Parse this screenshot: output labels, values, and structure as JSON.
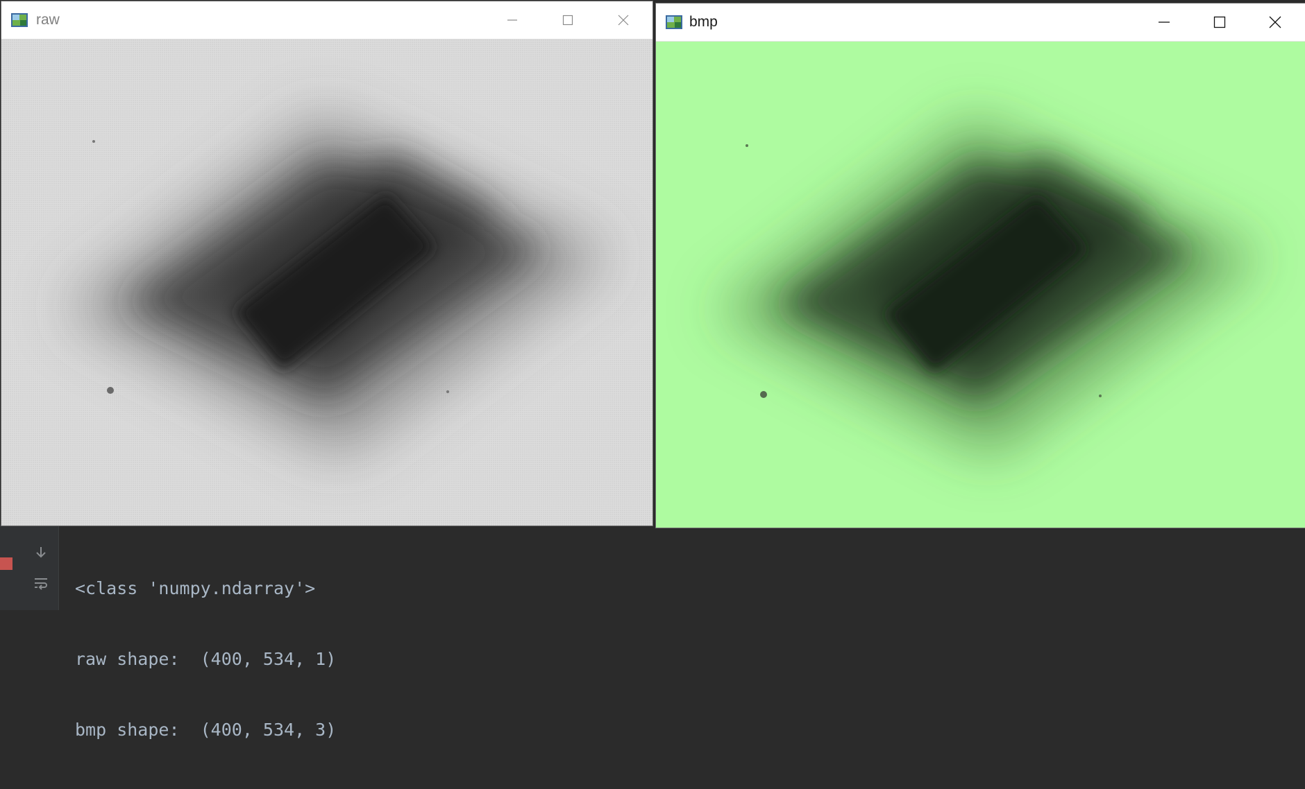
{
  "windows": {
    "raw": {
      "title": "raw"
    },
    "bmp": {
      "title": "bmp"
    }
  },
  "icons": {
    "app": "opencv-window-icon",
    "minimize": "minimize-icon",
    "maximize": "maximize-icon",
    "close": "close-icon",
    "console_down": "arrow-down-icon",
    "console_wrap": "soft-wrap-icon",
    "console_stop": "stop-icon"
  },
  "console": {
    "lines": [
      "<class 'numpy.ndarray'>",
      "raw shape:  (400, 534, 1)",
      "bmp shape:  (400, 534, 3)"
    ]
  },
  "colors": {
    "raw_background": "#dcdcdc",
    "bmp_background": "#aefba0",
    "console_background": "#2b2b2b",
    "console_text": "#a9b7c6",
    "stop": "#c75450"
  }
}
